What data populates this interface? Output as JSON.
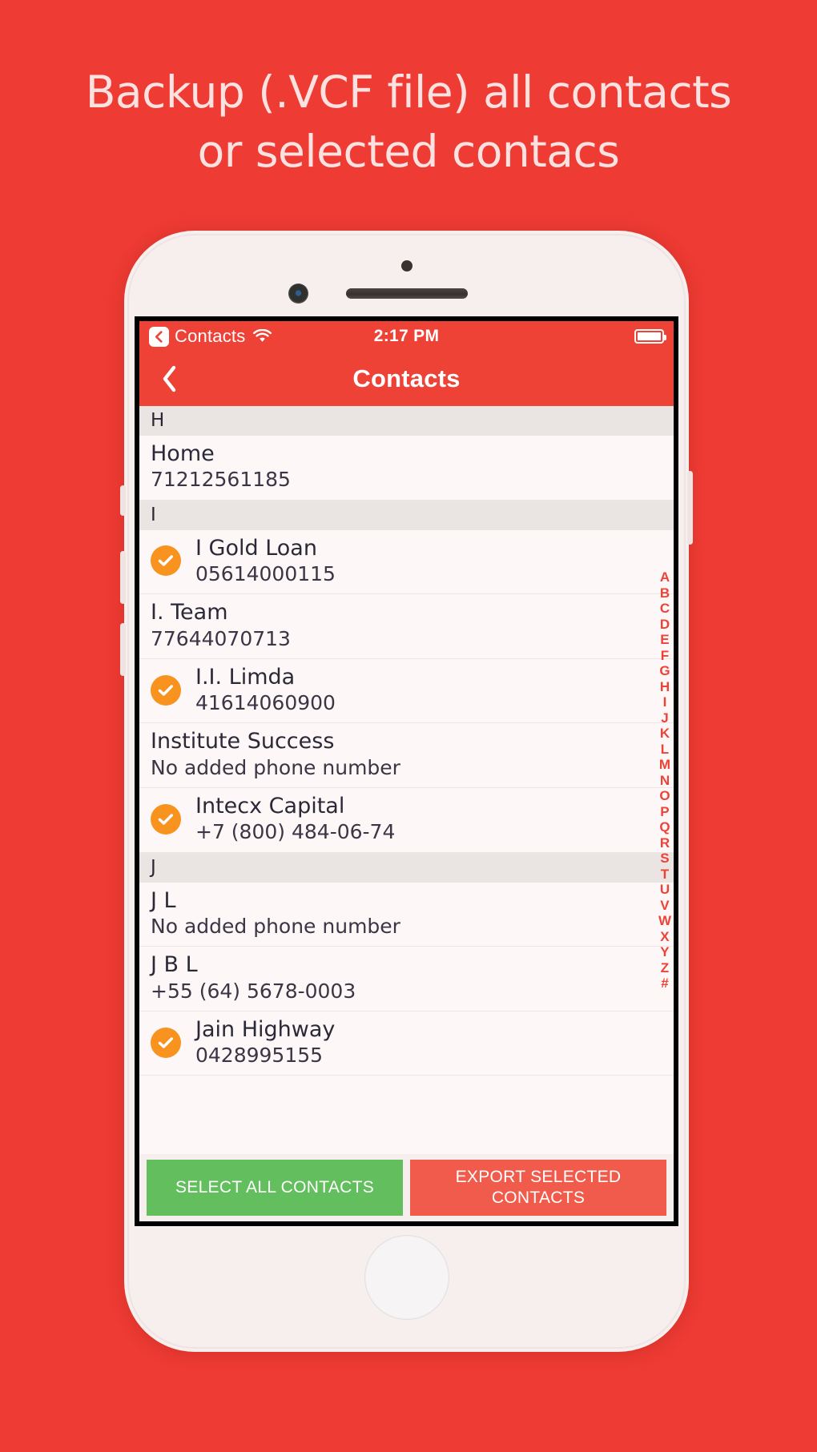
{
  "promo": {
    "headline_line1": "Backup (.VCF file) all contacts",
    "headline_line2": "or selected contacs",
    "background_color": "#ee3b33",
    "headline_color": "#fbe2e0"
  },
  "status_bar": {
    "back_app_label": "Contacts",
    "wifi_icon": "wifi-icon",
    "time": "2:17 PM",
    "battery_icon": "battery-full-icon"
  },
  "nav_bar": {
    "back_icon": "chevron-left-icon",
    "title": "Contacts",
    "accent_color": "#ee4237"
  },
  "contacts": {
    "sections": [
      {
        "letter": "H",
        "rows": [
          {
            "name": "Home",
            "phone": "71212561185",
            "selected": false
          }
        ]
      },
      {
        "letter": "I",
        "rows": [
          {
            "name": "I Gold Loan",
            "phone": "05614000115",
            "selected": true
          },
          {
            "name": "I. Team",
            "phone": "77644070713",
            "selected": false
          },
          {
            "name": "I.I. Limda",
            "phone": "41614060900",
            "selected": true
          },
          {
            "name": "Institute Success",
            "phone": "No added phone number",
            "selected": false
          },
          {
            "name": "Intecx Capital",
            "phone": "+7 (800) 484-06-74",
            "selected": true
          }
        ]
      },
      {
        "letter": "J",
        "rows": [
          {
            "name": "J L",
            "phone": "No added phone number",
            "selected": false
          },
          {
            "name": "J B L",
            "phone": "+55 (64) 5678-0003",
            "selected": false
          },
          {
            "name": "Jain Highway",
            "phone": "0428995155",
            "selected": true
          }
        ]
      }
    ],
    "selected_check_color": "#f7931e",
    "index_letters": [
      "A",
      "B",
      "C",
      "D",
      "E",
      "F",
      "G",
      "H",
      "I",
      "J",
      "K",
      "L",
      "M",
      "N",
      "O",
      "P",
      "Q",
      "R",
      "S",
      "T",
      "U",
      "V",
      "W",
      "X",
      "Y",
      "Z",
      "#"
    ],
    "index_color": "#ee4237"
  },
  "action_bar": {
    "select_all_label": "SELECT ALL CONTACTS",
    "select_all_color": "#63bf5e",
    "export_label": "EXPORT SELECTED CONTACTS",
    "export_color": "#f15b4b"
  }
}
